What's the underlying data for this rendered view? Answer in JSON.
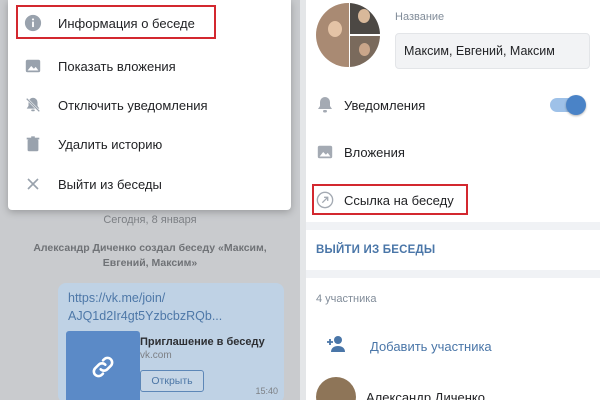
{
  "menu": {
    "items": [
      {
        "label": "Информация о беседе",
        "icon": "info-icon"
      },
      {
        "label": "Показать вложения",
        "icon": "image-icon"
      },
      {
        "label": "Отключить уведомления",
        "icon": "bell-off-icon"
      },
      {
        "label": "Удалить историю",
        "icon": "trash-icon"
      },
      {
        "label": "Выйти из беседы",
        "icon": "close-icon"
      }
    ]
  },
  "chat": {
    "date": "Сегодня, 8 января",
    "system_message": "Александр Диченко создал беседу «Максим, Евгений, Максим»",
    "link_line1": "https://vk.me/join/",
    "link_line2": "AJQ1d2Ir4gt5YzbcbzRQb...",
    "card_title": "Приглашение в беседу",
    "card_domain": "vk.com",
    "open_button": "Открыть",
    "time": "15:40"
  },
  "info": {
    "name_label": "Название",
    "name_value": "Максим, Евгений, Максим",
    "notifications": "Уведомления",
    "notifications_on": true,
    "attachments": "Вложения",
    "chat_link": "Ссылка на беседу",
    "leave": "ВЫЙТИ ИЗ БЕСЕДЫ",
    "members_count": "4 участника",
    "add_member": "Добавить участника",
    "members": [
      "Александр Диченко"
    ]
  },
  "colors": {
    "accent": "#4a76a8",
    "highlight": "#d3282f",
    "overlay": "#c9cbce"
  }
}
